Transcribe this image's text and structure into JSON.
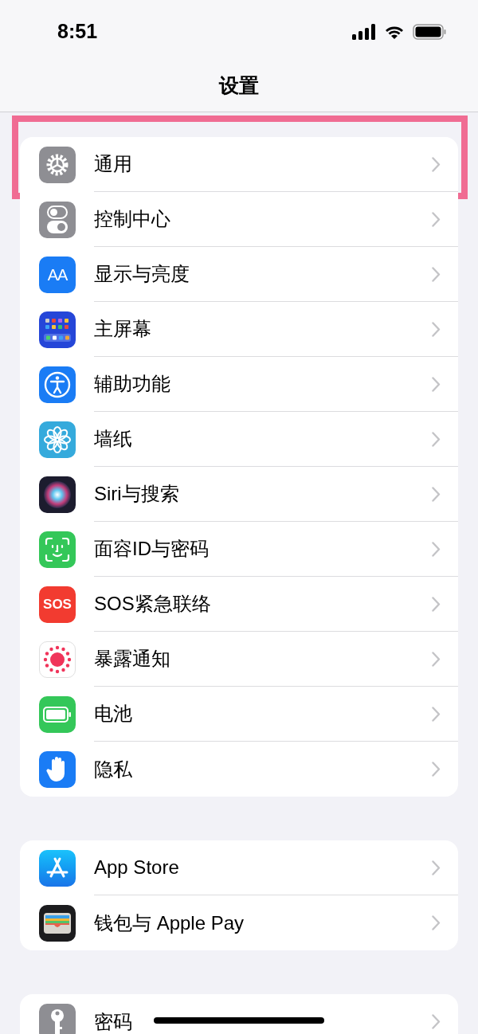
{
  "status_bar": {
    "time": "8:51"
  },
  "nav": {
    "title": "设置"
  },
  "annotation": {
    "kind": "frame"
  },
  "groups": [
    {
      "items": [
        {
          "label": "通用",
          "kind": "gear"
        },
        {
          "label": "控制中心",
          "kind": "toggles"
        },
        {
          "label": "显示与亮度",
          "kind": "text",
          "icon_text": "AA"
        },
        {
          "label": "主屏幕",
          "kind": "grid"
        },
        {
          "label": "辅助功能",
          "kind": "accessibility"
        },
        {
          "label": "墙纸",
          "kind": "flower"
        },
        {
          "label": "Siri与搜索",
          "kind": "orb"
        },
        {
          "label": "面容ID与密码",
          "kind": "face"
        },
        {
          "label": "SOS紧急联络",
          "kind": "sos",
          "icon_text": "SOS"
        },
        {
          "label": "暴露通知",
          "kind": "sun"
        },
        {
          "label": "电池",
          "kind": "battery"
        },
        {
          "label": "隐私",
          "kind": "hand"
        }
      ]
    },
    {
      "items": [
        {
          "label": "App Store",
          "kind": "appstore"
        },
        {
          "label": "钱包与 Apple Pay",
          "kind": "wallet"
        }
      ]
    },
    {
      "items": [
        {
          "label": "密码",
          "kind": "key"
        }
      ]
    }
  ]
}
